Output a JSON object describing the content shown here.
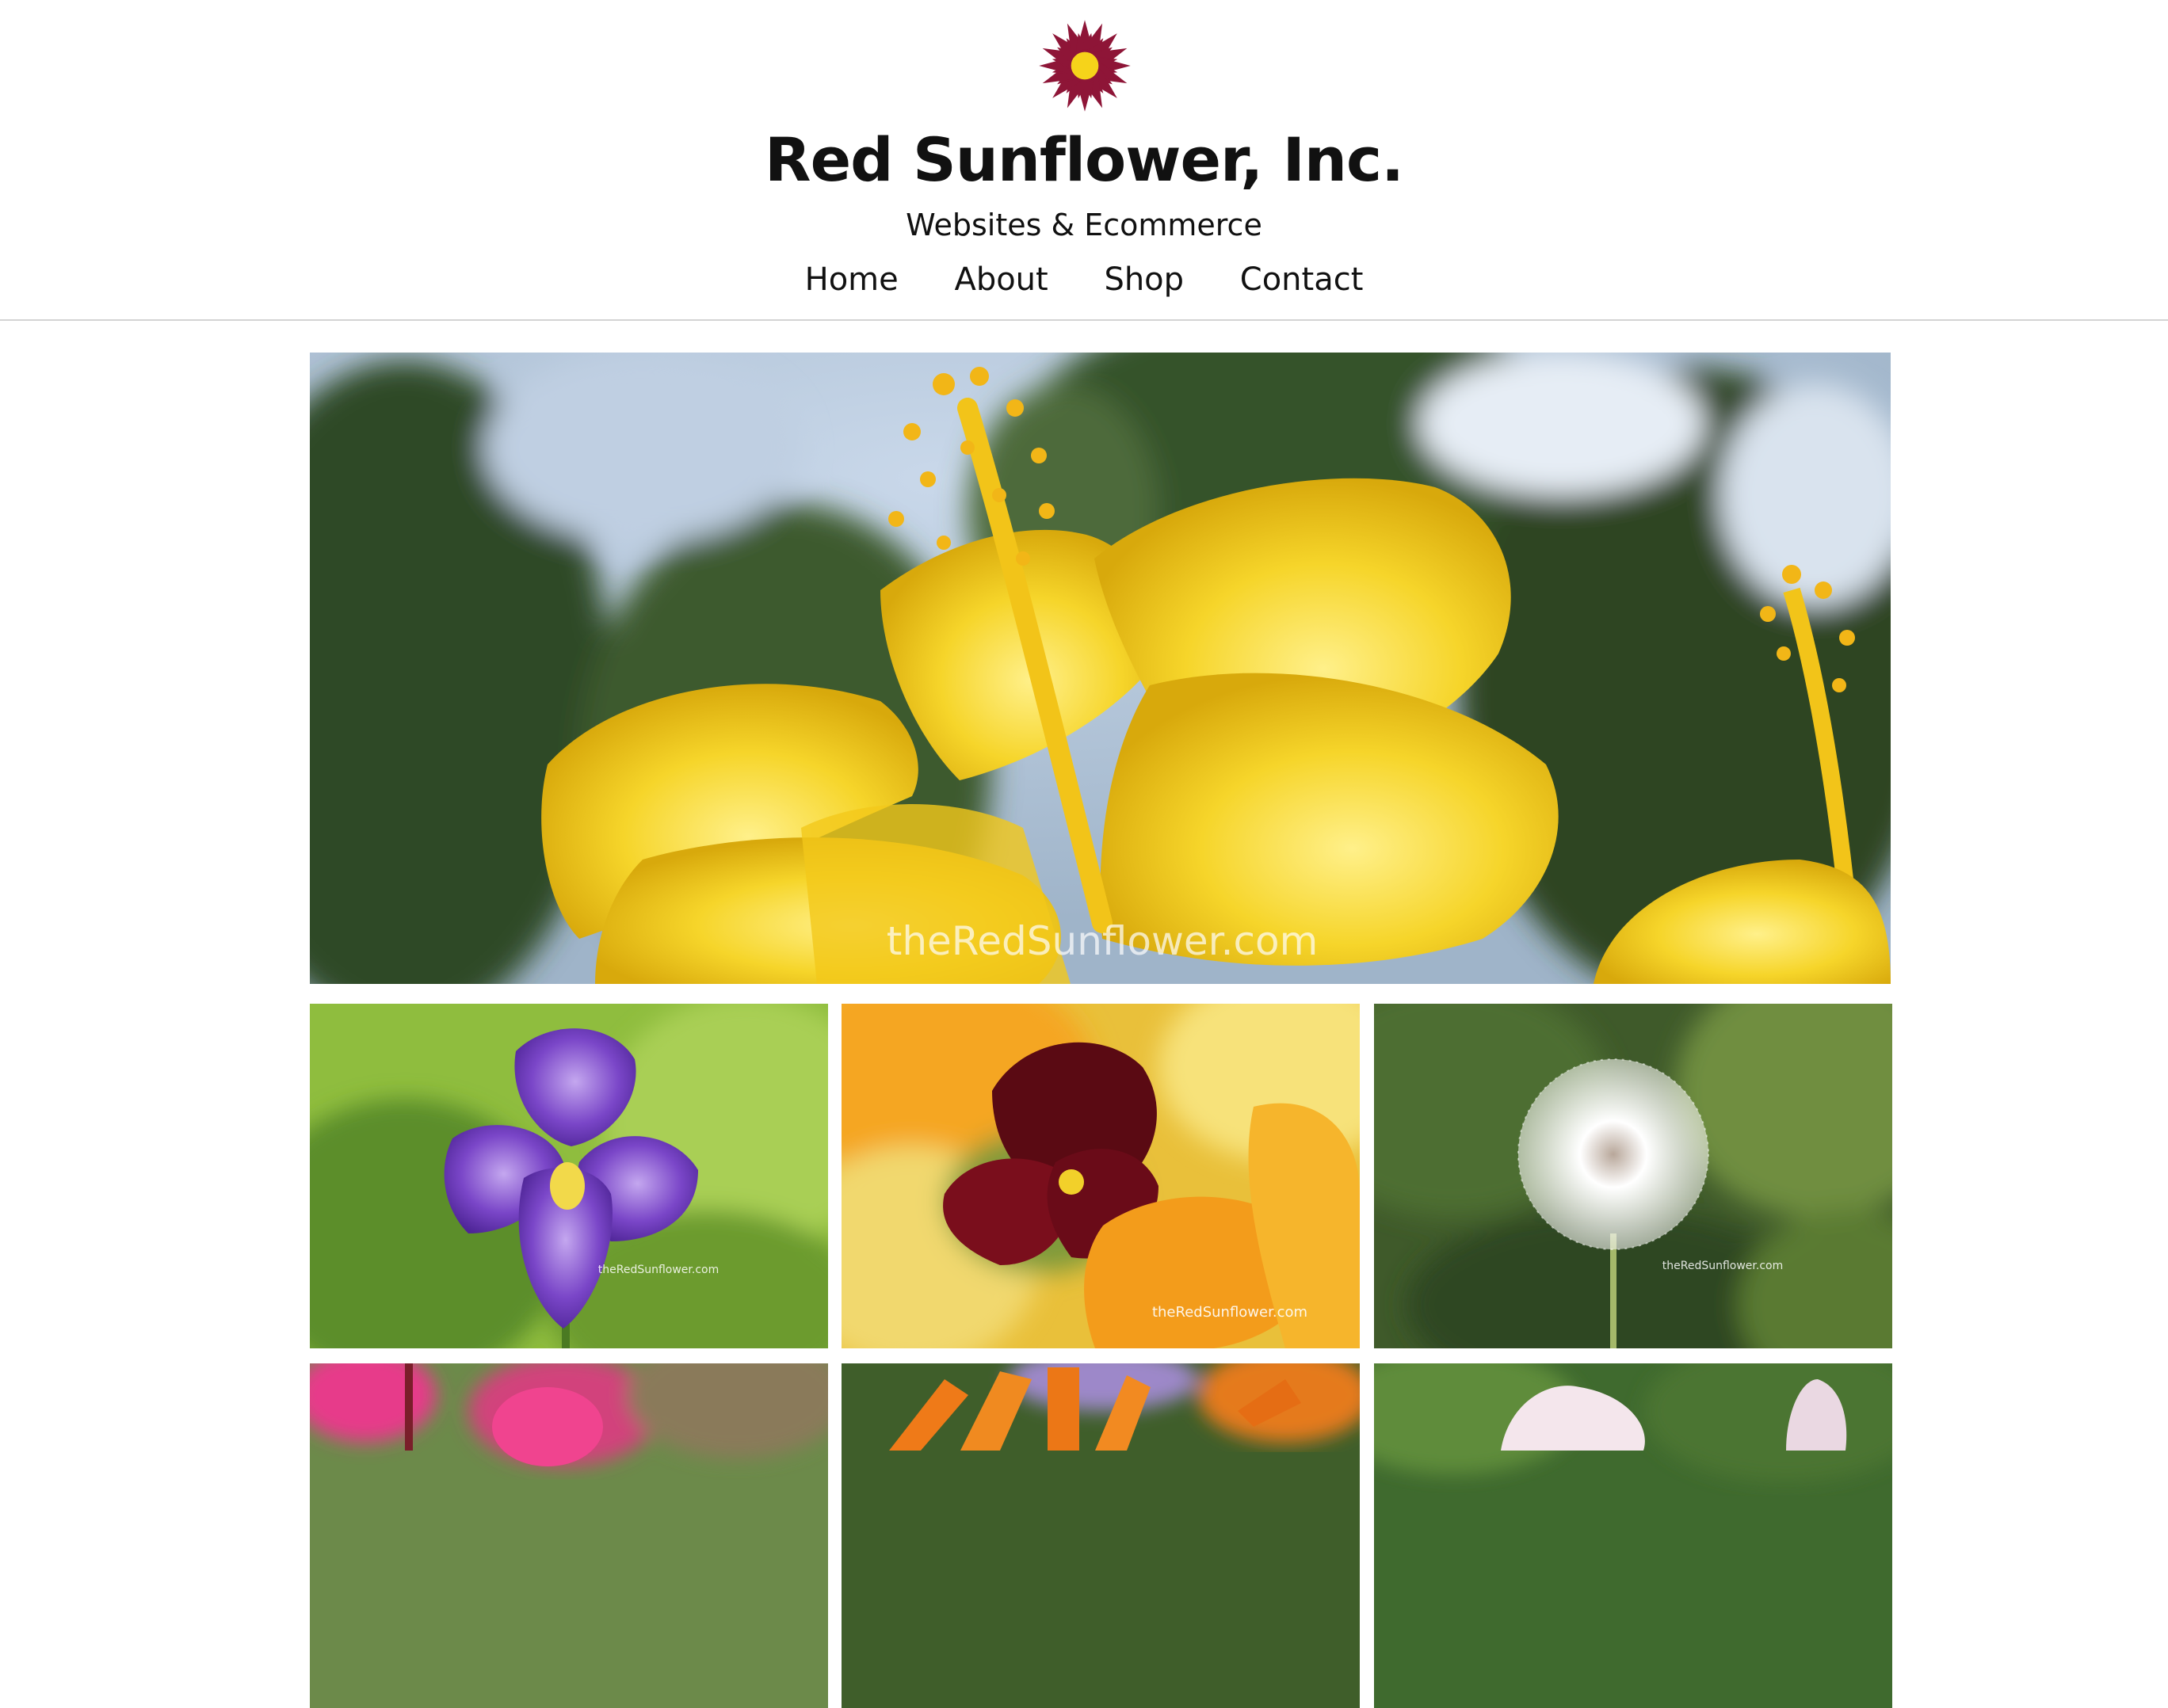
{
  "header": {
    "logo_icon": "red-sunflower-logo-icon",
    "title": "Red Sunflower, Inc.",
    "tagline": "Websites & Ecommerce"
  },
  "nav": {
    "items": [
      {
        "label": "Home"
      },
      {
        "label": "About"
      },
      {
        "label": "Shop"
      },
      {
        "label": "Contact"
      }
    ]
  },
  "gallery": {
    "hero": {
      "subject": "yellow hibiscus",
      "watermark": "theRedSunflower.com"
    },
    "tiles": [
      {
        "subject": "purple iris",
        "watermark": "theRedSunflower.com"
      },
      {
        "subject": "dark red pansy",
        "watermark": "theRedSunflower.com"
      },
      {
        "subject": "dandelion seed head",
        "watermark": "theRedSunflower.com"
      },
      {
        "subject": "pink flowers"
      },
      {
        "subject": "orange daisy"
      },
      {
        "subject": "white flower"
      }
    ]
  },
  "colors": {
    "logo_petal": "#8e1537",
    "logo_center": "#f6d31a",
    "divider": "#d4d4d4"
  }
}
